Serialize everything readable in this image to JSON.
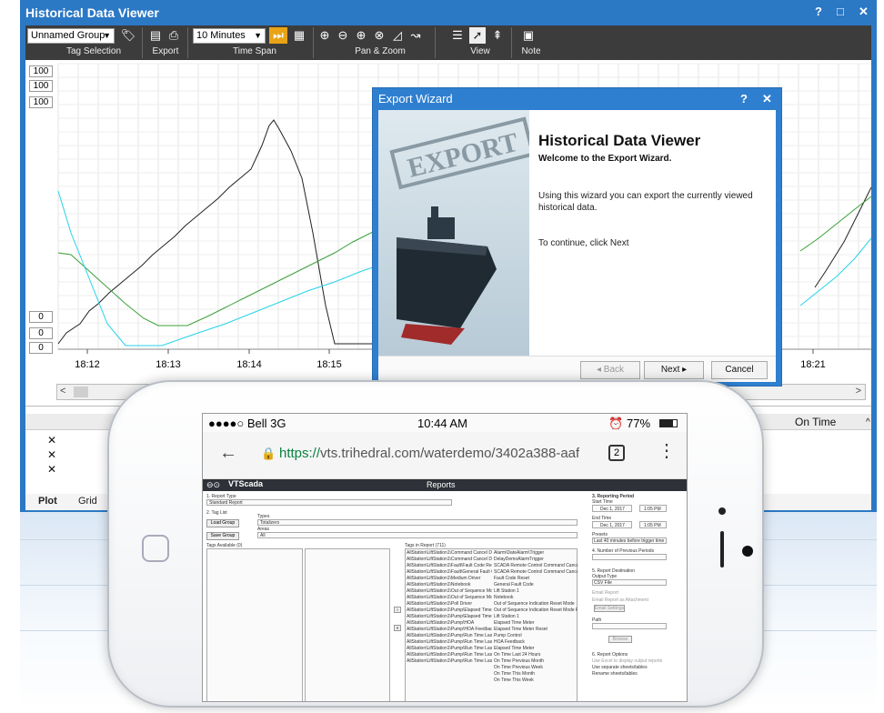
{
  "viewer": {
    "title": "Historical Data Viewer",
    "help": "?",
    "maximize": "□",
    "close": "✕",
    "toolbar": {
      "tag_group": "Unnamed Group",
      "time_span": "10 Minutes",
      "groups": [
        "Tag Selection",
        "Export",
        "Time Span",
        "Pan & Zoom",
        "View",
        "Note"
      ]
    },
    "scales_top": [
      "100",
      "100",
      "100"
    ],
    "scales_bottom": [
      "0",
      "0",
      "0"
    ],
    "scale_colors": [
      "#1ec8e0",
      "#222222",
      "#2c9b2c"
    ],
    "time_labels": [
      "18:12",
      "18:13",
      "18:14",
      "18:15",
      "18:21"
    ],
    "table": {
      "on_time_header": "On Time",
      "icons": [
        "✕",
        "👁",
        "⚙"
      ]
    },
    "tabs": [
      "Plot",
      "Grid"
    ]
  },
  "wizard": {
    "title": "Export Wizard",
    "help": "?",
    "close": "✕",
    "heading": "Historical Data Viewer",
    "welcome": "Welcome to the Export Wizard.",
    "description": "Using this wizard you can export the currently viewed historical data.",
    "continue_text": "To continue, click Next",
    "back": "Back",
    "next": "Next",
    "cancel": "Cancel",
    "stamp": "EXPORT"
  },
  "phone": {
    "carrier": "●●●●○ Bell  3G",
    "time": "10:44 AM",
    "battery": "77%",
    "url_secure": "https://",
    "url_rest": "vts.trihedral.com/waterdemo/3402a388-aaf3",
    "tab_count": "2",
    "app": {
      "brand": "VTScada",
      "page_title": "Reports",
      "report_type_label": "1. Report Type",
      "report_type": "Standard Report",
      "tag_list_label": "2. Tag List",
      "load_group": "Load Group",
      "save_group": "Save Group",
      "types_label": "Types",
      "types_value": "Totalizers",
      "areas_label": "Areas",
      "areas_value": "All",
      "tags_available": "Tags Available (0)",
      "tags_in_report": "Tags in Report (711)",
      "reporting_period": "3. Reporting Period",
      "start_time": "Start Time",
      "end_time": "End Time",
      "date": "Dec 1, 2017",
      "clock": "1:05 PM",
      "presets": "Presets",
      "preset_value": "Last 40 minutes before trigger time",
      "prev_periods": "4. Number of Previous Periods",
      "destination": "5. Report Destination",
      "output_type": "Output Type",
      "output_value": "CSV File",
      "email_report": "Email Report",
      "email_attach": "Email Report as Attachment",
      "email_settings": "Email Settings",
      "path": "Path",
      "browse": "Browse",
      "options": "6. Report Options",
      "opt1": "Use Excel to display output reports",
      "opt2": "Use separate sheets/tables",
      "opt3": "Rename sheets/tables",
      "tags_left": [
        "AllStation\\LiftStation1\\Command Cancel Delay",
        "AllStation\\LiftStation1\\Command Cancel Delay FB",
        "AllStation\\LiftStation1\\Fault\\Fault Code Reset",
        "AllStation\\LiftStation1\\Fault\\General Fault Code",
        "AllStation\\LiftStation1\\Medium Driver",
        "AllStation\\LiftStation1\\Notebook",
        "AllStation\\LiftStation1\\Out of Sequence Mode",
        "AllStation\\LiftStation1\\Out of Sequence Mode FB",
        "AllStation\\LiftStation1\\Poll Driver",
        "AllStation\\LiftStation1\\Pump\\Elapsed Time Meter",
        "AllStation\\LiftStation1\\Pump\\Elapsed Time Meter Reset",
        "AllStation\\LiftStation1\\Pump\\HOA",
        "AllStation\\LiftStation1\\Pump\\HOA Feedback",
        "AllStation\\LiftStation1\\Pump\\Run Time Last\\Elapsed Time",
        "AllStation\\LiftStation1\\Pump\\Run Time Last\\On Time Last 24",
        "AllStation\\LiftStation1\\Pump\\Run Time Last\\On Time Previous",
        "AllStation\\LiftStation1\\Pump\\Run Time Last\\On Time This",
        "AllStation\\LiftStation1\\Pump\\Run Time Last\\On Time This W"
      ],
      "tags_right": [
        "Alarm\\DateAlarm\\Trigger",
        "DelayDemoAlarmTrigger",
        "SCADA Remote Control Command Cancel Delay",
        "SCADA Remote Control Command Cancel Delay FB",
        "Fault Code Reset",
        "General Fault Code",
        "Lift Station 1",
        "Notebook",
        "Out of Sequence Indication Reset Mode",
        "Out of Sequence Indication Reset Mode FB",
        "Lift Station 1",
        "Elapsed Time Meter",
        "Elapsed Time Meter Reset",
        "Pump Control",
        "HOA Feedback",
        "Elapsed Time Meter",
        "On Time Last 24 Hours",
        "On Time Previous Month",
        "On Time Previous Week",
        "On Time This Month",
        "On Time This Week"
      ]
    }
  }
}
